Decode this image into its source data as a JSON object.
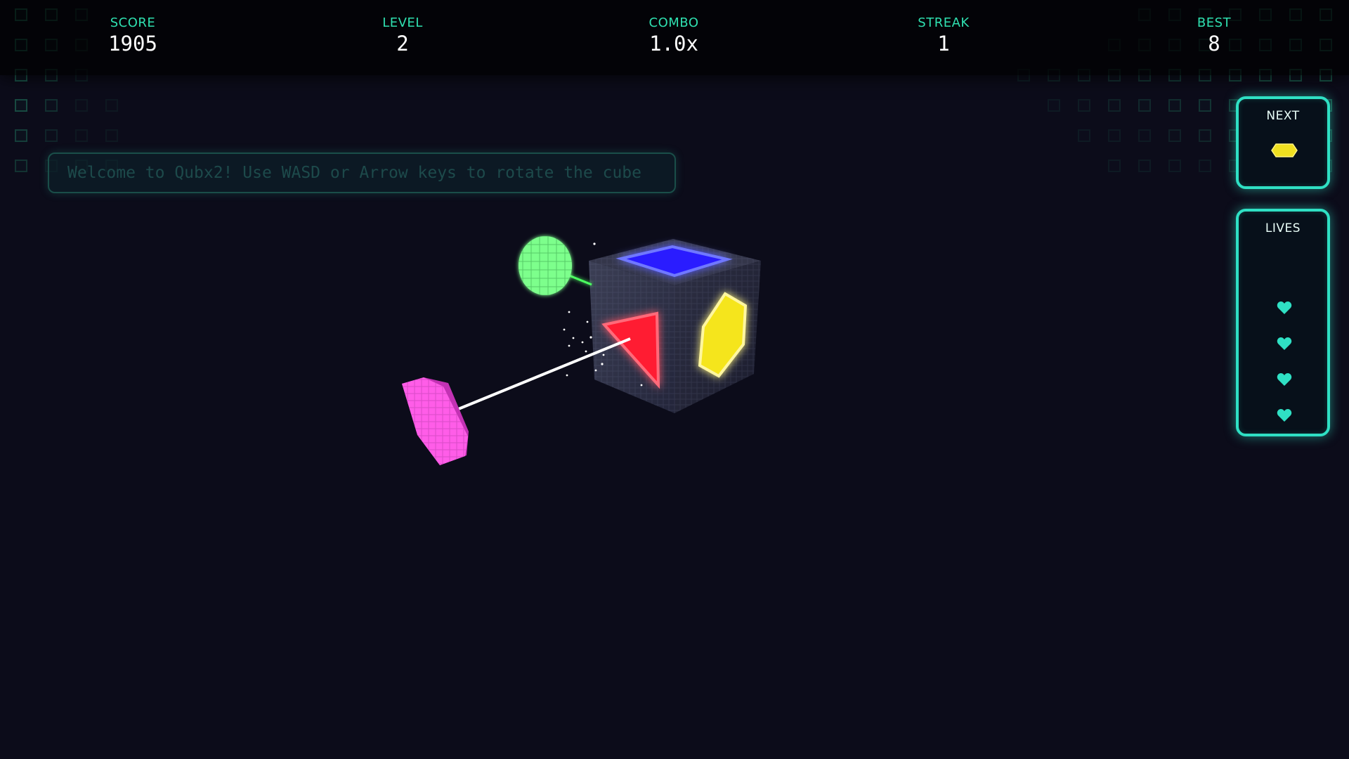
{
  "hud": {
    "score": {
      "label": "SCORE",
      "value": "1905"
    },
    "level": {
      "label": "LEVEL",
      "value": "2"
    },
    "combo": {
      "label": "COMBO",
      "value": "1.0x"
    },
    "streak": {
      "label": "STREAK",
      "value": "1"
    },
    "best": {
      "label": "BEST",
      "value": "8"
    }
  },
  "message": "Welcome to Qubx2! Use WASD or Arrow keys to rotate the cube",
  "next": {
    "label": "NEXT",
    "piece": "yellow-hexagon",
    "color": "#f0e020"
  },
  "lives": {
    "label": "LIVES",
    "count": 4,
    "color": "#2fe0c4"
  },
  "cube_faces": {
    "top": {
      "shape": "square",
      "color": "#3a2cff"
    },
    "left": {
      "shape": "triangle",
      "color": "#ff2a3a"
    },
    "right": {
      "shape": "hexagon",
      "color": "#f5e51c"
    }
  },
  "incoming": [
    {
      "shape": "circle",
      "color": "#7cff8a"
    },
    {
      "shape": "hexagon",
      "color": "#ff55e8"
    }
  ],
  "colors": {
    "accent": "#2fe0c4",
    "label": "#2fe0b0",
    "background": "#0c0c1a"
  }
}
